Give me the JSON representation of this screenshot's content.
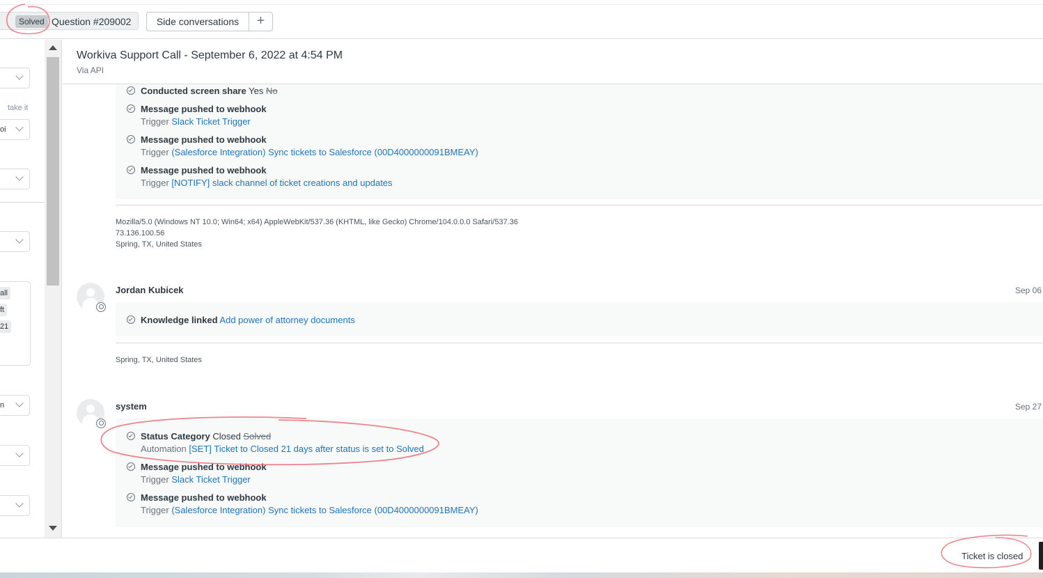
{
  "tabs": {
    "status_badge": "Solved",
    "ticket_label": "Question #209002",
    "side_conversations": "Side conversations",
    "add": "+"
  },
  "left_panel": {
    "take_it": "take it",
    "field_text": "oi",
    "tags": [
      "all",
      "ft",
      "21"
    ],
    "field_text_2": "n"
  },
  "conversation": {
    "subject": "Workiva Support Call - September 6, 2022 at 4:54 PM",
    "via": "Via API",
    "events_block_1": [
      {
        "bold": "Conducted screen share",
        "value": "Yes",
        "struck": "No"
      },
      {
        "bold": "Message pushed to webhook",
        "sub_prefix": "Trigger",
        "link": "Slack Ticket Trigger"
      },
      {
        "bold": "Message pushed to webhook",
        "sub_prefix": "Trigger",
        "link": "(Salesforce Integration) Sync tickets to Salesforce (00D4000000091BMEAY)"
      },
      {
        "bold": "Message pushed to webhook",
        "sub_prefix": "Trigger",
        "link": "[NOTIFY] slack channel of ticket creations and updates"
      }
    ],
    "meta_1": {
      "user_agent": "Mozilla/5.0 (Windows NT 10.0; Win64; x64) AppleWebKit/537.36 (KHTML, like Gecko) Chrome/104.0.0.0 Safari/537.36",
      "ip": "73.136.100.56",
      "location": "Spring, TX, United States"
    },
    "entry_2": {
      "author": "Jordan Kubicek",
      "date": "Sep 06",
      "event": {
        "bold": "Knowledge linked",
        "link": "Add power of attorney documents"
      },
      "location": "Spring, TX, United States"
    },
    "entry_3": {
      "author": "system",
      "date": "Sep 27",
      "events": [
        {
          "bold": "Status Category",
          "value": "Closed",
          "struck": "Solved",
          "sub_prefix": "Automation",
          "link": "[SET] Ticket to Closed 21 days after status is set to Solved"
        },
        {
          "bold": "Message pushed to webhook",
          "sub_prefix": "Trigger",
          "link": "Slack Ticket Trigger"
        },
        {
          "bold": "Message pushed to webhook",
          "sub_prefix": "Trigger",
          "link": "(Salesforce Integration) Sync tickets to Salesforce (00D4000000091BMEAY)"
        }
      ]
    }
  },
  "footer": {
    "status": "Ticket is closed"
  },
  "colors": {
    "link": "#1f73b7",
    "text": "#2f3941",
    "muted": "#68737d",
    "annotation": "#e8707a"
  }
}
